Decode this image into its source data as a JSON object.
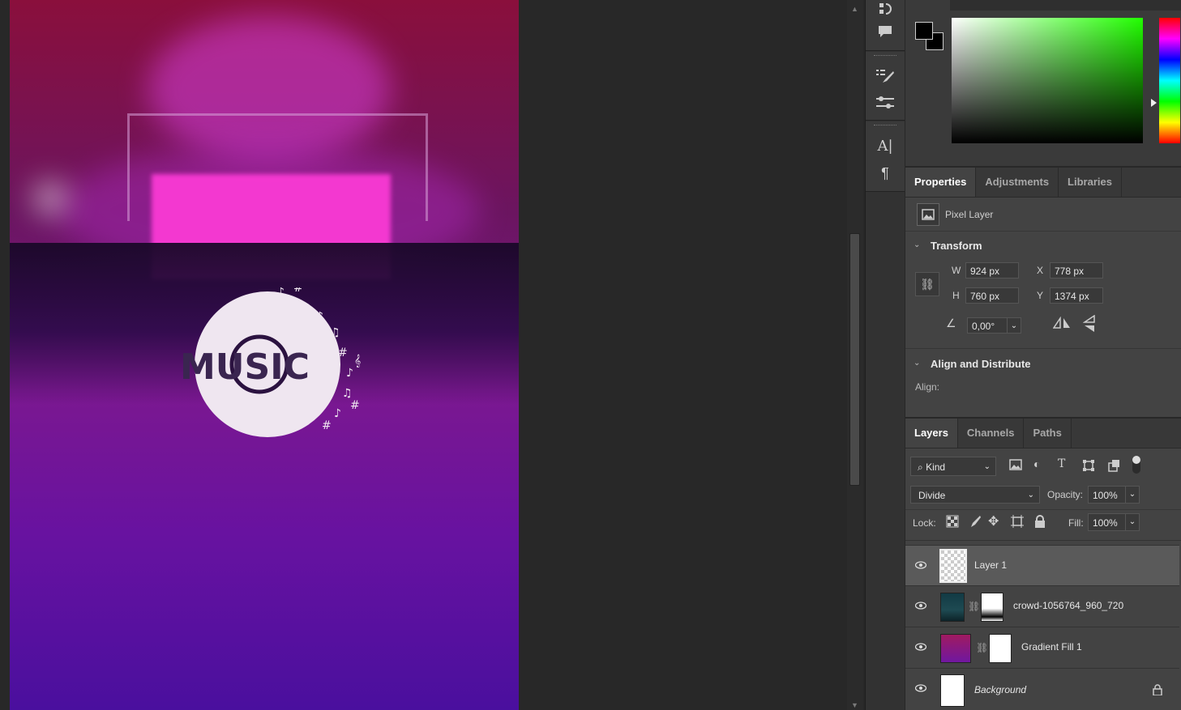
{
  "canvas": {
    "logo_text": "MUSIC"
  },
  "tabs_top": {
    "properties": "Properties",
    "adjustments": "Adjustments",
    "libraries": "Libraries"
  },
  "properties": {
    "layer_type": "Pixel Layer",
    "transform_title": "Transform",
    "w_label": "W",
    "w_value": "924 px",
    "h_label": "H",
    "h_value": "760 px",
    "x_label": "X",
    "x_value": "778 px",
    "y_label": "Y",
    "y_value": "1374 px",
    "angle_value": "0,00°",
    "align_title": "Align and Distribute",
    "align_label": "Align:"
  },
  "tabs_layers": {
    "layers": "Layers",
    "channels": "Channels",
    "paths": "Paths"
  },
  "layers_panel": {
    "filter_kind": "Kind",
    "blend_mode": "Divide",
    "opacity_label": "Opacity:",
    "opacity_value": "100%",
    "lock_label": "Lock:",
    "fill_label": "Fill:",
    "fill_value": "100%",
    "layers": [
      {
        "name": "Layer 1",
        "selected": true
      },
      {
        "name": "crowd-1056764_960_720",
        "selected": false
      },
      {
        "name": "Gradient Fill 1",
        "selected": false
      },
      {
        "name": "Background",
        "selected": false,
        "locked": true
      }
    ]
  },
  "colors": {
    "accent": "#0096ff",
    "panel_bg": "#434343",
    "selected_row": "#5a5a5a"
  }
}
